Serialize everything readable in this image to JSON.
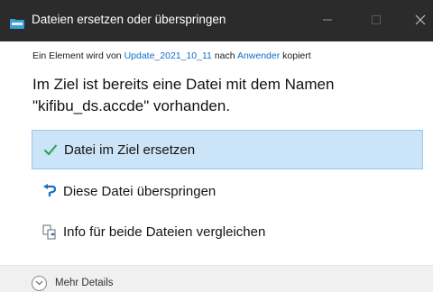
{
  "window": {
    "title": "Dateien ersetzen oder überspringen",
    "icon": "folder-transfer-icon",
    "controls": [
      "minimize",
      "maximize",
      "close"
    ]
  },
  "copy_info": {
    "prefix": "Ein Element wird von",
    "source": "Update_2021_10_11",
    "middle": "nach",
    "destination": "Anwender",
    "suffix": "kopiert"
  },
  "headline": {
    "line1": "Im Ziel ist bereits eine Datei mit dem Namen",
    "line2": "\"kifibu_ds.accde\" vorhanden."
  },
  "options": [
    {
      "label": "Datei im Ziel ersetzen",
      "icon": "checkmark-icon",
      "selected": true
    },
    {
      "label": "Diese Datei überspringen",
      "icon": "skip-arrow-icon",
      "selected": false
    },
    {
      "label": "Info für beide Dateien vergleichen",
      "icon": "compare-files-icon",
      "selected": false
    }
  ],
  "footer": {
    "details_label": "Mehr Details",
    "icon": "chevron-down-circle-icon"
  },
  "colors": {
    "titlebar": "#2b2b2b",
    "link": "#0f6fc6",
    "selected_bg": "#cce4f7",
    "selected_border": "#99c9ef",
    "check": "#2e9e4a",
    "skip": "#1b6ec2"
  }
}
